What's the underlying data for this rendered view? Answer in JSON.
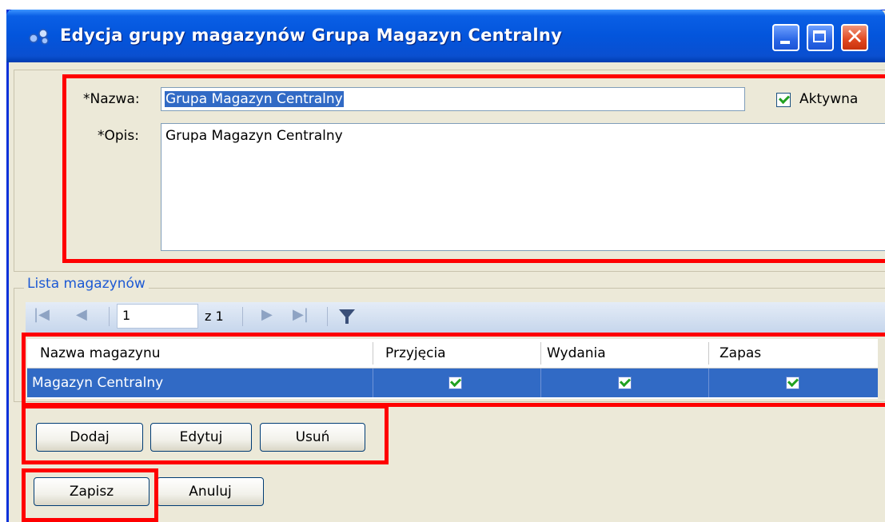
{
  "window": {
    "title": "Edycja grupy magazynów Grupa Magazyn Centralny",
    "close_glyph": "✕"
  },
  "form": {
    "name_label": "*Nazwa:",
    "name_value": "Grupa Magazyn Centralny",
    "description_label": "*Opis:",
    "description_value": "Grupa Magazyn Centralny",
    "active_label": "Aktywna",
    "active_checked": true
  },
  "warehouse_list": {
    "legend": "Lista magazynów",
    "pager": {
      "current_page": "1",
      "of_text": "z 1",
      "first_glyph": "|◀",
      "prev_glyph": "◀",
      "next_glyph": "▶",
      "last_glyph": "▶|"
    },
    "columns": [
      "Nazwa magazynu",
      "Przyjęcia",
      "Wydania",
      "Zapas"
    ],
    "rows": [
      {
        "name": "Magazyn Centralny",
        "receipts": true,
        "issues": true,
        "stock": true
      }
    ]
  },
  "buttons": {
    "add": "Dodaj",
    "edit": "Edytuj",
    "delete": "Usuń",
    "save": "Zapisz",
    "cancel": "Anuluj"
  },
  "colors": {
    "annotation_red": "#ff0000",
    "selection_blue": "#316ac5",
    "titlebar_blue": "#0355dc"
  }
}
